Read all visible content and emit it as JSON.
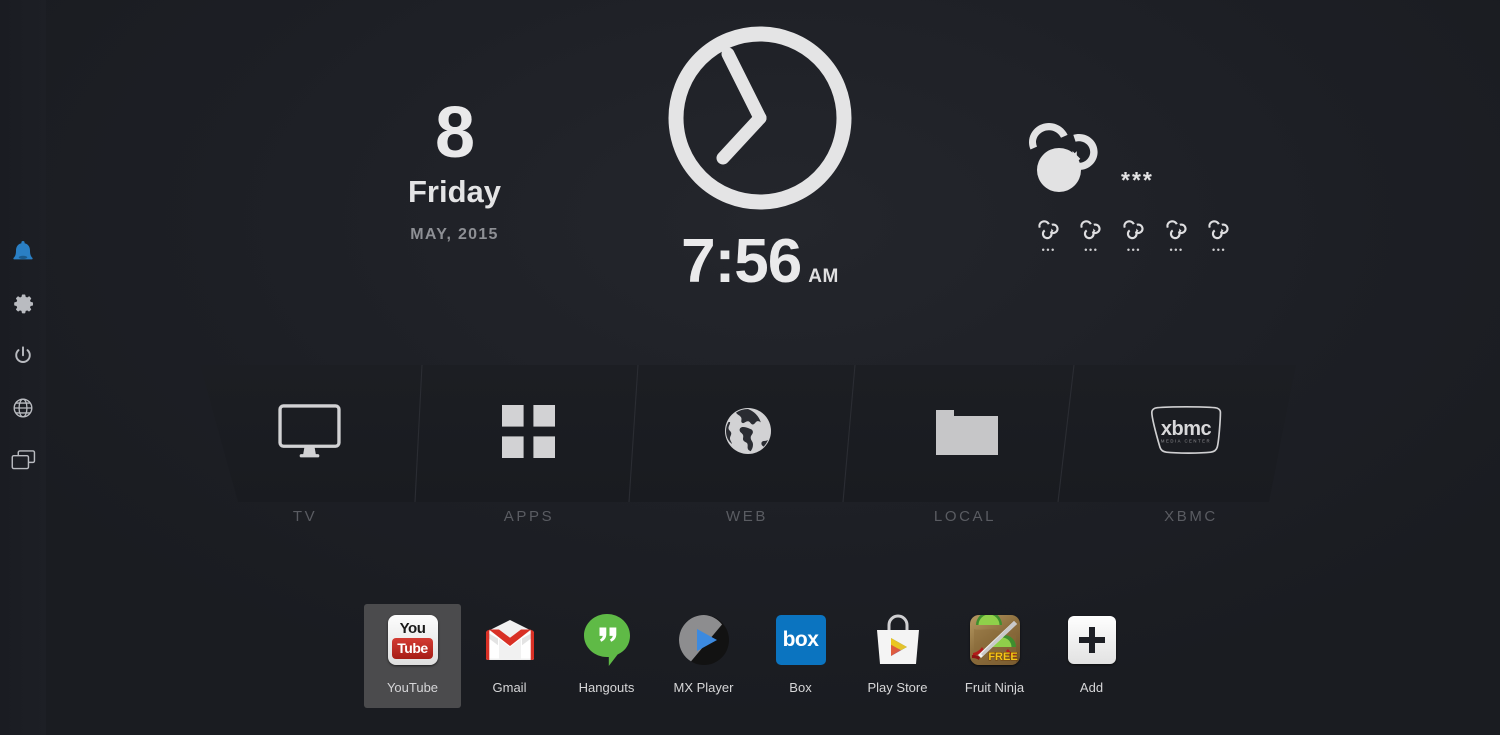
{
  "sidebar": {
    "items": [
      {
        "name": "notifications",
        "icon": "bell-icon",
        "color": "#2a7fc4",
        "active": true
      },
      {
        "name": "settings",
        "icon": "gear-icon",
        "color": "#b9bbc0",
        "active": false
      },
      {
        "name": "power",
        "icon": "power-icon",
        "color": "#b9bbc0",
        "active": false
      },
      {
        "name": "network",
        "icon": "globe-icon",
        "color": "#b9bbc0",
        "active": false
      },
      {
        "name": "recents",
        "icon": "windows-icon",
        "color": "#b9bbc0",
        "active": false
      }
    ]
  },
  "date": {
    "day_number": "8",
    "weekday": "Friday",
    "month_year": "MAY, 2015"
  },
  "clock": {
    "time": "7:56",
    "meridiem": "AM",
    "hour_angle": 238,
    "minute_angle": 336
  },
  "weather": {
    "icon": "cloud-refresh-icon",
    "temperature": "***",
    "forecast": [
      {
        "icon": "cloud-refresh-icon",
        "value": "•••"
      },
      {
        "icon": "cloud-refresh-icon",
        "value": "•••"
      },
      {
        "icon": "cloud-refresh-icon",
        "value": "•••"
      },
      {
        "icon": "cloud-refresh-icon",
        "value": "•••"
      },
      {
        "icon": "cloud-refresh-icon",
        "value": "•••"
      }
    ]
  },
  "categories": [
    {
      "label": "TV",
      "icon": "monitor-icon"
    },
    {
      "label": "APPS",
      "icon": "grid-icon"
    },
    {
      "label": "WEB",
      "icon": "globe-earth-icon"
    },
    {
      "label": "LOCAL",
      "icon": "folder-icon"
    },
    {
      "label": "XBMC",
      "icon": "xbmc-logo-icon"
    }
  ],
  "xbmc_logo": {
    "wordmark": "xbmc",
    "subtitle": "MEDIA CENTER"
  },
  "dock": {
    "apps": [
      {
        "label": "YouTube",
        "icon": "youtube-icon",
        "selected": true
      },
      {
        "label": "Gmail",
        "icon": "gmail-icon",
        "selected": false
      },
      {
        "label": "Hangouts",
        "icon": "hangouts-icon",
        "selected": false
      },
      {
        "label": "MX Player",
        "icon": "mxplayer-icon",
        "selected": false
      },
      {
        "label": "Box",
        "icon": "box-icon",
        "selected": false
      },
      {
        "label": "Play Store",
        "icon": "playstore-icon",
        "selected": false
      },
      {
        "label": "Fruit Ninja",
        "icon": "fruitninja-icon",
        "selected": false
      },
      {
        "label": "Add",
        "icon": "plus-icon",
        "selected": false
      }
    ]
  },
  "youtube_icon": {
    "top_text": "You",
    "bottom_text": "Tube"
  },
  "box_icon": {
    "text": "box"
  },
  "fruitninja_icon": {
    "badge": "FREE"
  },
  "colors": {
    "background": "#1d1f25",
    "accent_blue": "#2a7fc4",
    "icon_gray": "#b9bbc0",
    "label_gray": "#5a5c62",
    "text_white": "#e9e9ea",
    "selection": "#4b4b4d"
  }
}
